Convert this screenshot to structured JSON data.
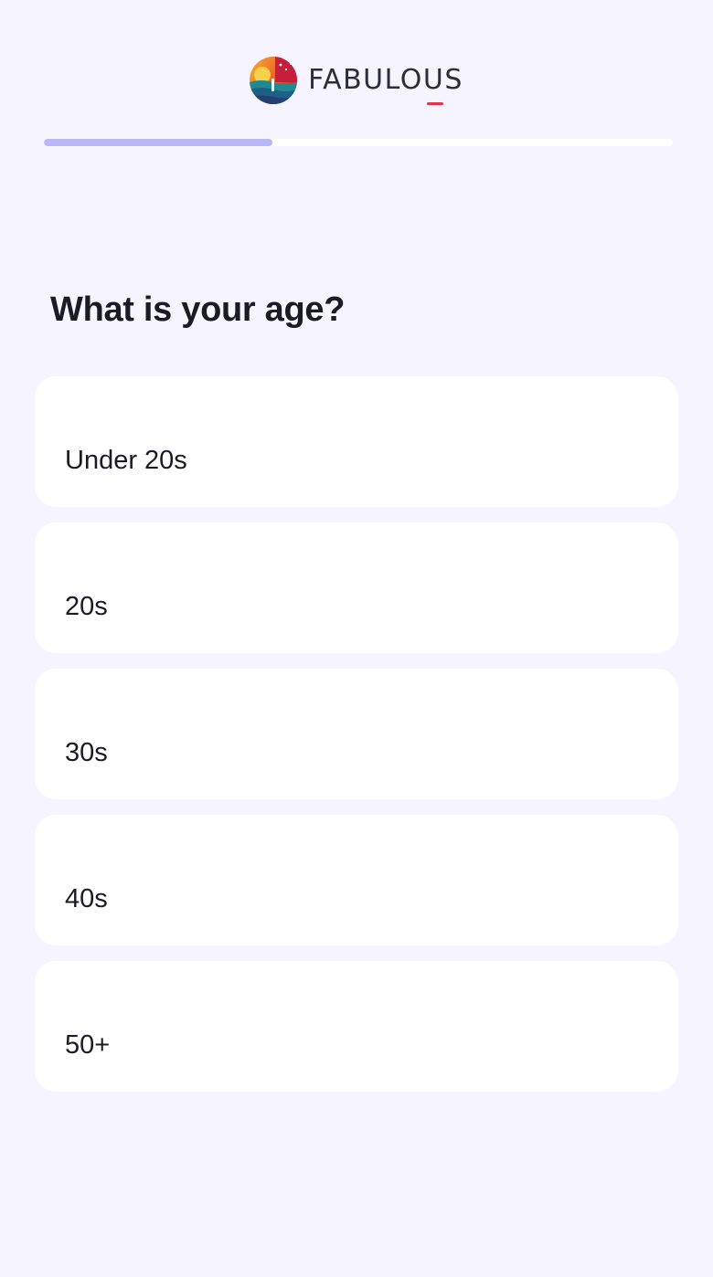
{
  "brand": {
    "name": "FABULOUS",
    "logo_icon": "fabulous-logo-icon",
    "underline_color": "#e0344a"
  },
  "progress": {
    "fraction": 0.364,
    "fill_color": "#b9b6f5",
    "track_color": "#ffffff"
  },
  "question": {
    "title": "What is your age?"
  },
  "options": [
    {
      "label": "Under 20s"
    },
    {
      "label": "20s"
    },
    {
      "label": "30s"
    },
    {
      "label": "40s"
    },
    {
      "label": "50+"
    }
  ],
  "colors": {
    "background": "#f6f5ff",
    "card": "#ffffff",
    "text": "#1b1b24"
  }
}
